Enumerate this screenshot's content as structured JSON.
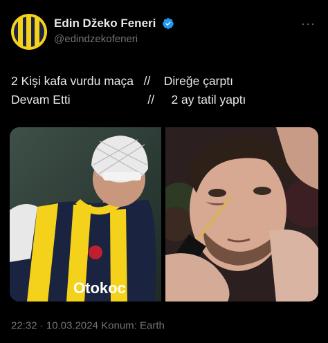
{
  "author": {
    "display_name": "Edin Džeko Feneri",
    "handle": "@edindzekofeneri"
  },
  "tweet": {
    "lines": [
      "2 Kişi kafa vurdu maça   //    Direğe çarptı",
      "Devam Etti                       //     2 ay tatil yaptı"
    ]
  },
  "media": {
    "left_sponsor": "Otokoc"
  },
  "meta": {
    "time": "22:32",
    "separator": "·",
    "date": "10.03.2024",
    "location": "Konum: Earth"
  },
  "colors": {
    "verified": "#1d9bf0",
    "secondary_text": "#71767b",
    "kit_yellow": "#f4d21b",
    "kit_navy": "#1a2340"
  },
  "icons": {
    "verified": "verified-badge-icon",
    "more": "more-dots-icon"
  }
}
